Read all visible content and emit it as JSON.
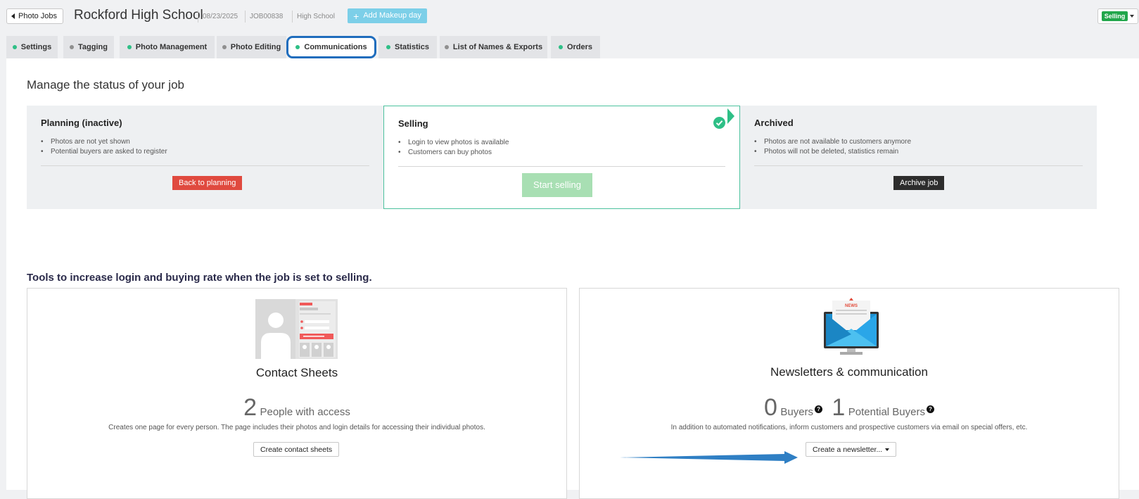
{
  "header": {
    "back_label": "Photo Jobs",
    "job_title": "Rockford High School",
    "date": "08/23/2025",
    "job_id": "JOB00838",
    "job_type": "High School",
    "makeup_label": "Add Makeup day",
    "status_badge": "Selling",
    "colors": {
      "makeup_button": "#7ccfe8",
      "status_badge": "#21a64b"
    }
  },
  "tabs": [
    {
      "label": "Settings",
      "dot": "#2ebf86"
    },
    {
      "label": "Tagging",
      "dot": "#8f8f8f"
    },
    {
      "label": "Photo Management",
      "dot": "#2ebf86"
    },
    {
      "label": "Photo Editing",
      "dot": "#8f8f8f"
    },
    {
      "label": "Communications",
      "dot": "#2ebf86",
      "active": true
    },
    {
      "label": "Statistics",
      "dot": "#2ebf86"
    },
    {
      "label": "List of Names & Exports",
      "dot": "#8f8f8f"
    },
    {
      "label": "Orders",
      "dot": "#2ebf86"
    }
  ],
  "status_section": {
    "title": "Manage the status of your job",
    "cards": [
      {
        "title": "Planning (inactive)",
        "bullets": [
          "Photos are not yet shown",
          "Potential buyers are asked to register"
        ],
        "button": "Back to planning"
      },
      {
        "title": "Selling",
        "bullets": [
          "Login to view photos is available",
          "Customers can buy photos"
        ],
        "button": "Start selling",
        "current": true
      },
      {
        "title": "Archived",
        "bullets": [
          "Photos are not available to customers anymore",
          "Photos will not be deleted, statistics remain"
        ],
        "button": "Archive job"
      }
    ]
  },
  "tools": {
    "title": "Tools to increase login and buying rate when the job is set to selling.",
    "contact_sheets": {
      "title": "Contact Sheets",
      "count": "2",
      "count_label": "People with access",
      "description": "Creates one page for every person. The page includes their photos and login details for accessing their individual photos.",
      "button": "Create contact sheets"
    },
    "newsletters": {
      "title": "Newsletters & communication",
      "news_tag": "NEWS",
      "buyers_count": "0",
      "buyers_label": "Buyers",
      "potential_count": "1",
      "potential_label": "Potential Buyers",
      "help_glyph": "?",
      "description": "In addition to automated notifications, inform customers and prospective customers via email on special offers, etc.",
      "button": "Create a newsletter..."
    }
  }
}
